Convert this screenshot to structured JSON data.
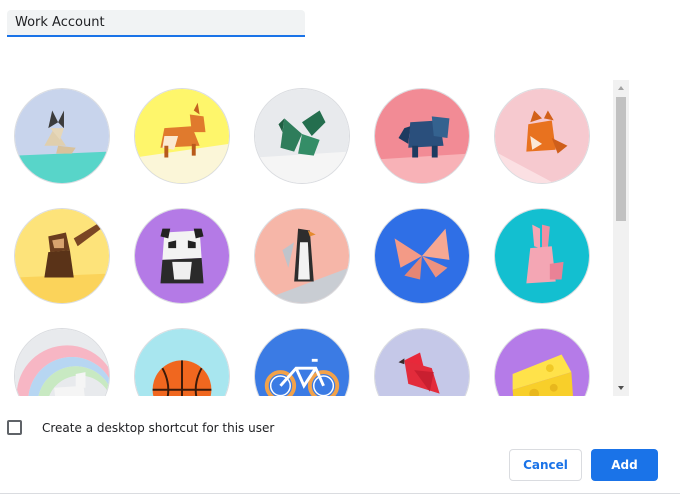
{
  "profile_name": {
    "value": "Work Account"
  },
  "avatars": [
    {
      "name": "origami-cat",
      "bg": "#c8d4ec"
    },
    {
      "name": "origami-corgi",
      "bg": "#fef66b"
    },
    {
      "name": "origami-dragon",
      "bg": "#e8eaed"
    },
    {
      "name": "origami-elephant",
      "bg": "#f28b95"
    },
    {
      "name": "origami-fox",
      "bg": "#f6c9cf"
    },
    {
      "name": "origami-monkey",
      "bg": "#fde37a"
    },
    {
      "name": "origami-panda",
      "bg": "#b47ae6"
    },
    {
      "name": "origami-penguin",
      "bg": "#f6b6a8"
    },
    {
      "name": "origami-butterfly",
      "bg": "#2f6fe6"
    },
    {
      "name": "origami-rabbit",
      "bg": "#13bfd0"
    },
    {
      "name": "origami-unicorn",
      "bg": "#e8eaed"
    },
    {
      "name": "basketball",
      "bg": "#a8e6ef"
    },
    {
      "name": "bicycle",
      "bg": "#3b7be4"
    },
    {
      "name": "bird",
      "bg": "#c5c8e8"
    },
    {
      "name": "cheese",
      "bg": "#b57be8"
    }
  ],
  "shortcut": {
    "label": "Create a desktop shortcut for this user",
    "checked": false
  },
  "buttons": {
    "cancel_label": "Cancel",
    "add_label": "Add"
  },
  "colors": {
    "accent": "#1a73e8",
    "border": "#dadce0"
  }
}
